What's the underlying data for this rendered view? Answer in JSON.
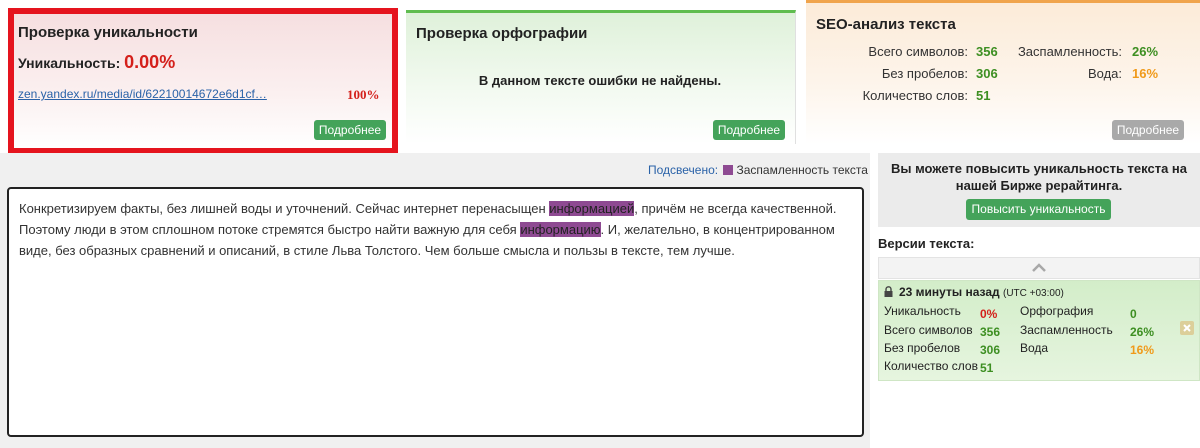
{
  "uniqueness": {
    "title": "Проверка уникальности",
    "label": "Уникальность:",
    "value": "0.00%",
    "source_link": "zen.yandex.ru/media/id/62210014672e6d1cf…",
    "source_percent": "100%",
    "details_button": "Подробнее"
  },
  "spelling": {
    "title": "Проверка орфографии",
    "message": "В данном тексте ошибки не найдены.",
    "details_button": "Подробнее"
  },
  "seo": {
    "title": "SEO-анализ текста",
    "total_chars_label": "Всего символов:",
    "total_chars": "356",
    "no_spaces_label": "Без пробелов:",
    "no_spaces": "306",
    "word_count_label": "Количество слов:",
    "word_count": "51",
    "spam_label": "Заспамленность:",
    "spam": "26%",
    "water_label": "Вода:",
    "water": "16%",
    "details_button": "Подробнее"
  },
  "highlight": {
    "label": "Подсвечено:",
    "legend": "Заспамленность текста",
    "color": "#8e4a92"
  },
  "text": {
    "part1": "Конкретизируем факты, без лишней воды и уточнений. Сейчас интернет перенасыщен ",
    "hl1": "информацией",
    "part2": ", причём не всегда качественной. Поэтому люди в этом сплошном потоке стремятся быстро найти важную для себя ",
    "hl2": "информацию",
    "part3": ". И, желательно, в концентрированном виде, без образных сравнений и описаний, в стиле Льва Толстого. Чем больше смысла и пользы в тексте, тем лучше."
  },
  "promo": {
    "text": "Вы можете повысить уникальность текста на нашей Бирже рерайтинга.",
    "button": "Повысить уникальность"
  },
  "versions": {
    "title": "Версии текста:",
    "entry": {
      "time": "23 минуты назад",
      "tz": "(UTC +03:00)",
      "uniq_label": "Уникальность",
      "uniq": "0%",
      "chars_label": "Всего символов",
      "chars": "356",
      "nospace_label": "Без пробелов",
      "nospace": "306",
      "words_label": "Количество слов",
      "words": "51",
      "spell_label": "Орфография",
      "spell": "0",
      "spam_label": "Заспамленность",
      "spam": "26%",
      "water_label": "Вода",
      "water": "16%"
    }
  },
  "colors": {
    "accent_red": "#e5141e",
    "button_green": "#44a35a",
    "value_green": "#3d8f22",
    "value_orange": "#f09a1a"
  }
}
